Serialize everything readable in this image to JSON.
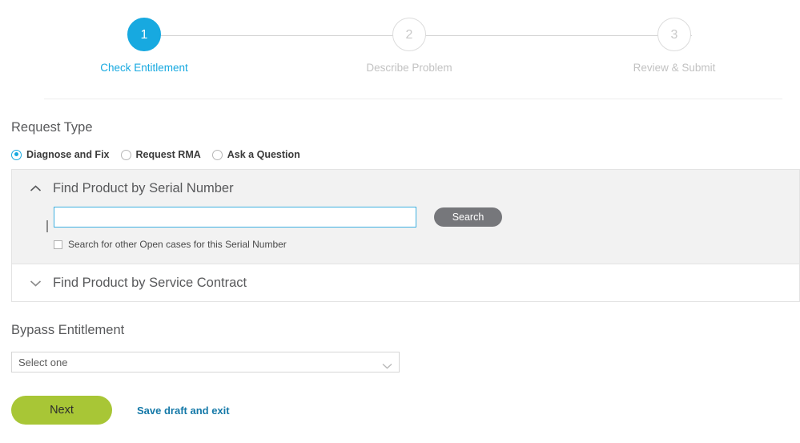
{
  "stepper": {
    "steps": [
      {
        "number": "1",
        "label": "Check Entitlement",
        "state": "active"
      },
      {
        "number": "2",
        "label": "Describe Problem",
        "state": "inactive"
      },
      {
        "number": "3",
        "label": "Review & Submit",
        "state": "inactive"
      }
    ],
    "active_color": "#17a9e0",
    "inactive_color": "#c2c2c2"
  },
  "request_type": {
    "title": "Request Type",
    "options": [
      {
        "label": "Diagnose and Fix",
        "selected": true
      },
      {
        "label": "Request RMA",
        "selected": false
      },
      {
        "label": "Ask a Question",
        "selected": false
      }
    ]
  },
  "accordion": {
    "serial": {
      "title": "Find Product by Serial Number",
      "expanded": true,
      "chevron": "chevron-up-icon",
      "input_value": "",
      "input_placeholder": "",
      "search_label": "Search",
      "checkbox_label": "Search for other Open cases for this Serial Number",
      "checkbox_checked": false
    },
    "contract": {
      "title": "Find Product by Service Contract",
      "expanded": false,
      "chevron": "chevron-down-icon"
    }
  },
  "bypass": {
    "title": "Bypass Entitlement",
    "selected_value": "Select one",
    "chevron": "chevron-down-icon"
  },
  "footer": {
    "next_label": "Next",
    "save_label": "Save draft and exit",
    "next_color": "#a8c636",
    "link_color": "#1579a8"
  }
}
